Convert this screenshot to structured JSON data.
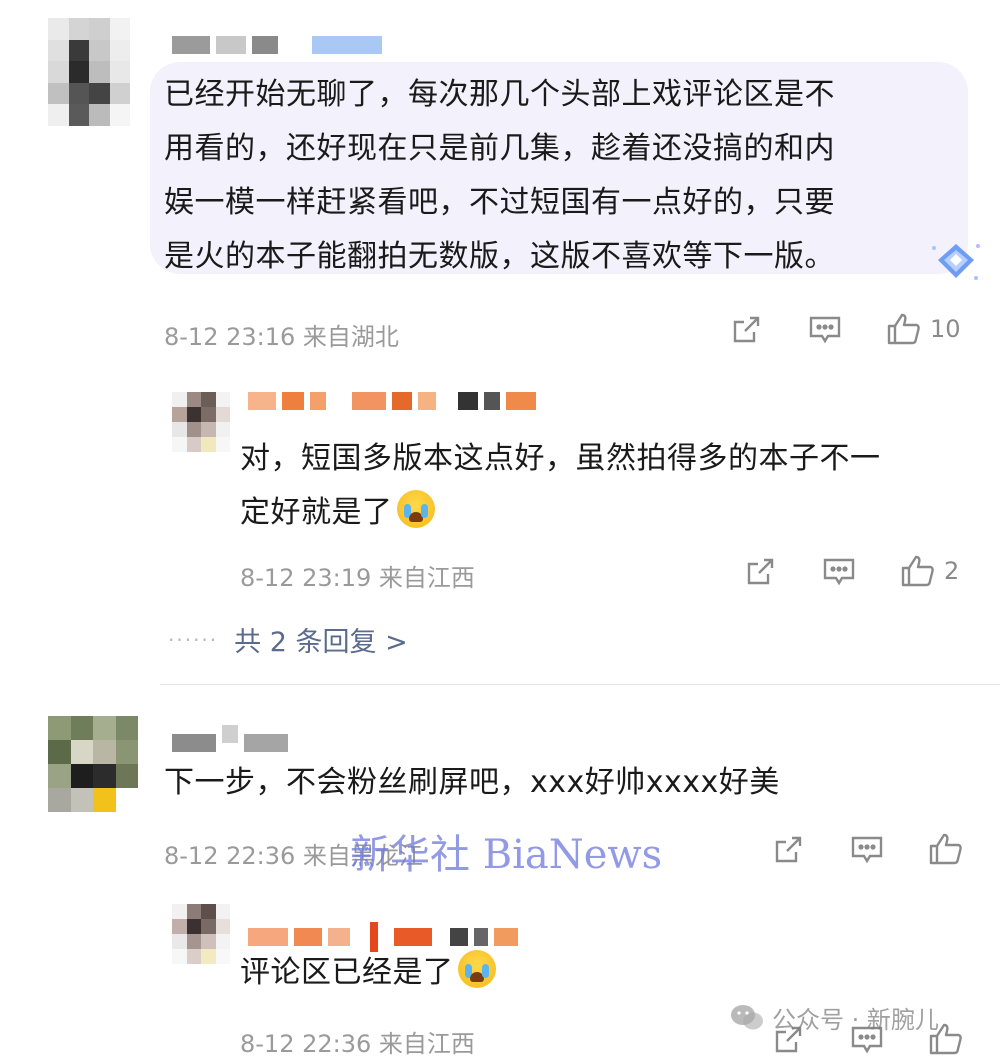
{
  "comments": [
    {
      "text_lines": [
        "已经开始无聊了，每次那几个头部上戏评论区是不",
        "用看的，还好现在只是前几集，趁着还没搞的和内",
        "娱一模一样赶紧看吧，不过短国有一点好的，只要",
        "是火的本子能翻拍无数版，这版不喜欢等下一版。"
      ],
      "meta": "8-12 23:16 来自湖北",
      "likes": "10",
      "reply": {
        "text_lines": [
          "对，短国多版本这点好，虽然拍得多的本子不一",
          "定好就是了"
        ],
        "meta": "8-12 23:19 来自江西",
        "likes": "2"
      },
      "more_replies": "共 2 条回复 >"
    },
    {
      "text_lines": [
        "下一步，不会粉丝刷屏吧，xxx好帅xxxx好美"
      ],
      "meta": "8-12 22:36 来自黑龙江",
      "likes": "",
      "reply": {
        "text_lines": [
          "评论区已经是了"
        ],
        "meta": "8-12 22:36 来自江西",
        "likes": ""
      }
    }
  ],
  "watermark": "新华社 BiaNews",
  "account_mark": "公众号 · 新腕儿",
  "colors": {
    "bubble": "#f3f1fb",
    "meta": "#9a9a9a",
    "link": "#5b6b8e",
    "watermark": "#6e78dc"
  }
}
